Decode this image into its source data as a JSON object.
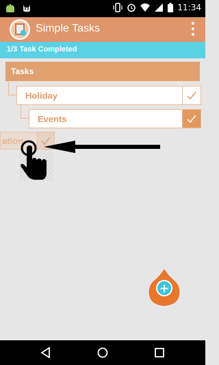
{
  "status_bar": {
    "time": "11:34",
    "icons": [
      "android-icon",
      "cat-icon",
      "vibrate-icon",
      "alarm-icon",
      "wifi-icon",
      "signal-icon",
      "battery-icon"
    ]
  },
  "app_bar": {
    "title": "Simple Tasks",
    "icon": "app-icon",
    "menu_icon": "overflow-menu-icon"
  },
  "progress": {
    "label": "1/3 Task Completed",
    "fraction": 0.3333
  },
  "tasks_header": {
    "label": "Tasks"
  },
  "tasks": [
    {
      "label": "Holiday",
      "completed": false,
      "level": 1
    },
    {
      "label": "Events",
      "completed": true,
      "level": 2
    },
    {
      "label": "ation",
      "completed": true,
      "level": 1,
      "state": "dragging"
    }
  ],
  "gesture": {
    "icon": "hand-pointer-icon",
    "arrow_icon": "arrow-left-icon"
  },
  "fab": {
    "label": "+",
    "icon": "add-icon"
  },
  "nav_bar": {
    "buttons": [
      "back-icon",
      "home-icon",
      "recents-icon"
    ]
  },
  "colors": {
    "app_bar": "#e0956a",
    "progress": "#5bd1e6",
    "tasks_header": "#e0a06f",
    "check_active": "#e1995e",
    "fab_inner": "#3cc3dd",
    "fab_outer": "#e8772e"
  }
}
